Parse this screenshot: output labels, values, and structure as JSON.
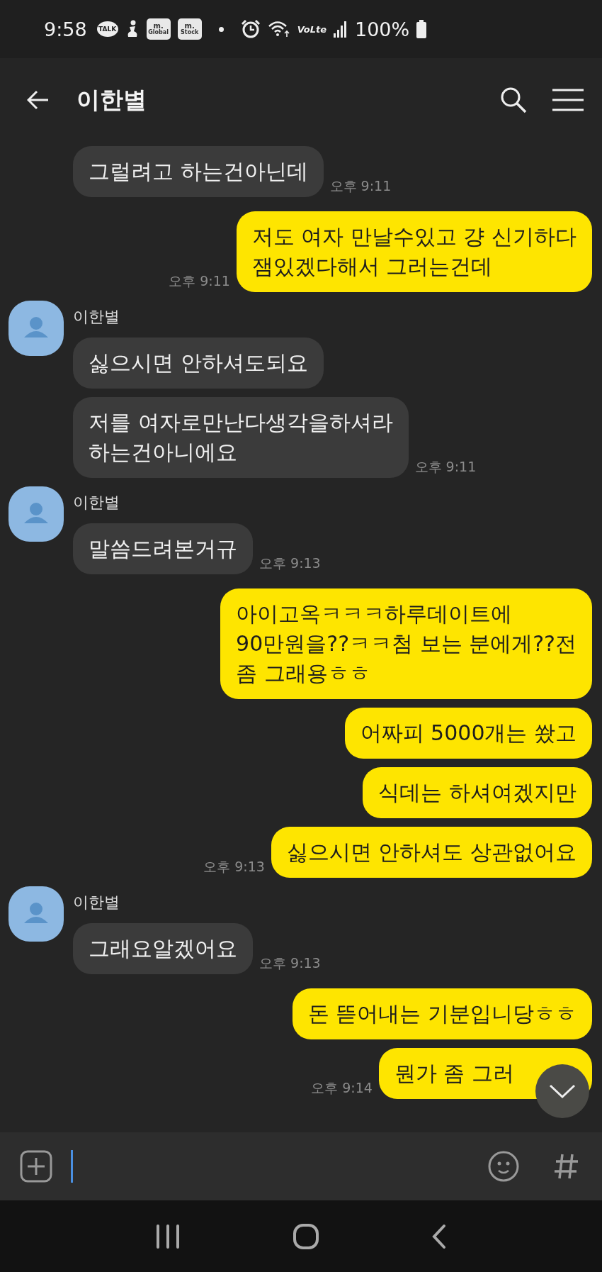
{
  "status_bar": {
    "time": "9:58",
    "talk_badge": "TALK",
    "app_badges": [
      {
        "top": "m.",
        "bottom": "Global"
      },
      {
        "top": "m.",
        "bottom": "Stock"
      }
    ],
    "network_label": "VoLte",
    "battery": "100%"
  },
  "header": {
    "title": "이한별"
  },
  "messages": [
    {
      "kind": "incoming",
      "text": "그럴려고 하는건아닌데",
      "time": "오후 9:11"
    },
    {
      "kind": "outgoing",
      "text": "저도 여자 만날수있고 걍 신기하다\n잼있겠다해서 그러는건데",
      "time": "오후 9:11"
    },
    {
      "kind": "incoming",
      "sender": "이한별",
      "text": "싫으시면 안하셔도되요"
    },
    {
      "kind": "incoming",
      "text": "저를 여자로만난다생각을하셔라\n하는건아니에요",
      "time": "오후 9:11"
    },
    {
      "kind": "incoming",
      "sender": "이한별",
      "text": "말씀드려본거규",
      "time": "오후 9:13"
    },
    {
      "kind": "outgoing",
      "text": "아이고옥ㅋㅋㅋ하루데이트에\n90만원을??ㅋㅋ첨 보는 분에게??전\n좀 그래용ㅎㅎ"
    },
    {
      "kind": "outgoing",
      "text": "어짜피 5000개는 쐈고"
    },
    {
      "kind": "outgoing",
      "text": "식데는 하셔여겠지만"
    },
    {
      "kind": "outgoing",
      "text": "싫으시면 안하셔도 상관없어요",
      "time": "오후 9:13"
    },
    {
      "kind": "incoming",
      "sender": "이한별",
      "text": "그래요알겠어요",
      "time": "오후 9:13"
    },
    {
      "kind": "outgoing",
      "text": "돈 뜯어내는 기분입니당ㅎㅎ"
    },
    {
      "kind": "outgoing",
      "text": "뭔가 좀 그러",
      "time": "오후 9:14"
    }
  ]
}
